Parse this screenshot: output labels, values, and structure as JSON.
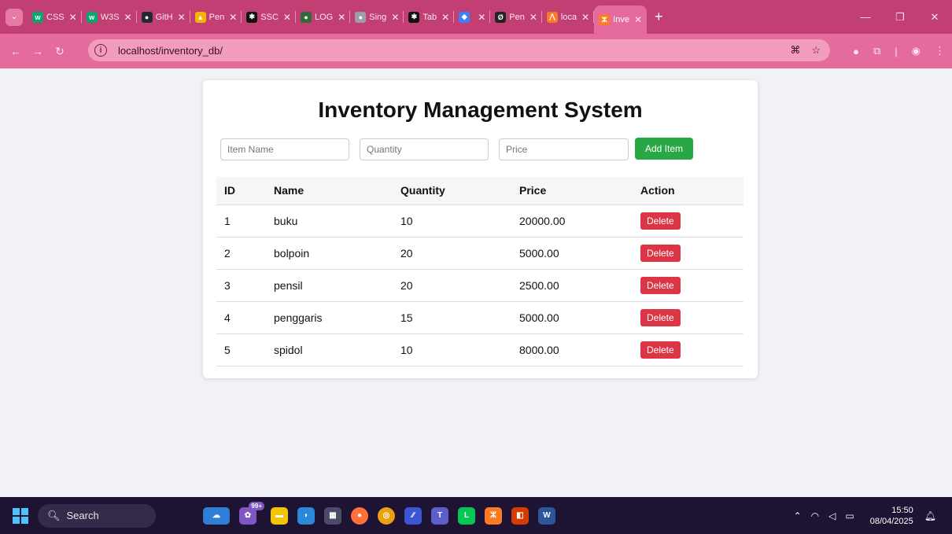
{
  "browser": {
    "tabs": [
      {
        "label": "CSS",
        "icon": "w3schools-icon",
        "color": "#04aa6d",
        "glyph": "w"
      },
      {
        "label": "W3S",
        "icon": "w3schools-icon",
        "color": "#04aa6d",
        "glyph": "w"
      },
      {
        "label": "GitH",
        "icon": "github-icon",
        "color": "#24292f",
        "glyph": "●"
      },
      {
        "label": "Pen",
        "icon": "google-drive-icon",
        "color": "#f4b400",
        "glyph": "▲"
      },
      {
        "label": "SSC",
        "icon": "chatgpt-icon",
        "color": "#111111",
        "glyph": "✱"
      },
      {
        "label": "LOG",
        "icon": "leaf-icon",
        "color": "#2f6b3b",
        "glyph": "●"
      },
      {
        "label": "Sing",
        "icon": "globe-icon",
        "color": "#9aa0a6",
        "glyph": "●"
      },
      {
        "label": "Tab",
        "icon": "chatgpt-icon",
        "color": "#111111",
        "glyph": "✱"
      },
      {
        "label": "",
        "icon": "photo-icon",
        "color": "#3b82f6",
        "glyph": "◆"
      },
      {
        "label": "Pen",
        "icon": "slash-icon",
        "color": "#222222",
        "glyph": "Ø"
      },
      {
        "label": "loca",
        "icon": "xampp-icon",
        "color": "#fb7a24",
        "glyph": "⋀"
      }
    ],
    "active_tab": {
      "label": "Inve",
      "icon": "xampp-icon",
      "color": "#fb7a24",
      "glyph": "ⵣ"
    },
    "url": "localhost/inventory_db/"
  },
  "page": {
    "title": "Inventory Management System",
    "form": {
      "item_name_placeholder": "Item Name",
      "quantity_placeholder": "Quantity",
      "price_placeholder": "Price",
      "add_label": "Add Item"
    },
    "table": {
      "headers": [
        "ID",
        "Name",
        "Quantity",
        "Price",
        "Action"
      ],
      "rows": [
        {
          "id": "1",
          "name": "buku",
          "quantity": "10",
          "price": "20000.00"
        },
        {
          "id": "2",
          "name": "bolpoin",
          "quantity": "20",
          "price": "5000.00"
        },
        {
          "id": "3",
          "name": "pensil",
          "quantity": "20",
          "price": "2500.00"
        },
        {
          "id": "4",
          "name": "penggaris",
          "quantity": "15",
          "price": "5000.00"
        },
        {
          "id": "5",
          "name": "spidol",
          "quantity": "10",
          "price": "8000.00"
        }
      ],
      "delete_label": "Delete"
    },
    "colors": {
      "add_button": "#28a745",
      "delete_button": "#dc3545",
      "tabbar": "#c13f72",
      "addressbar": "#e56b9c"
    }
  },
  "taskbar": {
    "search_label": "Search",
    "badge": "99+",
    "time": "15:50",
    "date": "08/04/2025"
  }
}
